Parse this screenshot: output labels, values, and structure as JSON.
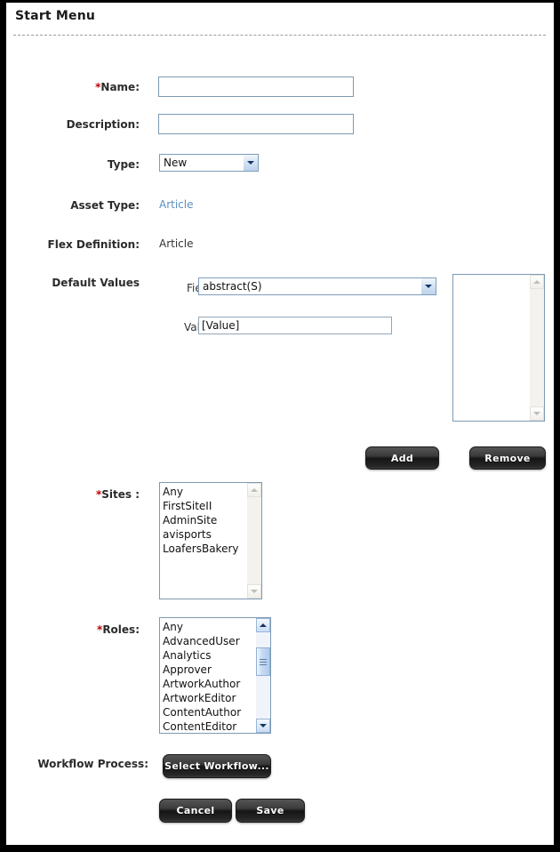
{
  "page": {
    "title": "Start Menu"
  },
  "form": {
    "name": {
      "label": "Name:",
      "required_marker": "*",
      "value": "",
      "placeholder": ""
    },
    "description": {
      "label": "Description:",
      "value": "",
      "placeholder": ""
    },
    "type": {
      "label": "Type:",
      "selected": "New",
      "options": [
        "New"
      ]
    },
    "asset_type": {
      "label": "Asset Type:",
      "value": "Article"
    },
    "flex_definition": {
      "label": "Flex Definition:",
      "value": "Article"
    },
    "default_values": {
      "label": "Default Values",
      "field": {
        "label": "Field:",
        "selected": "abstract(S)",
        "options": [
          "abstract(S)"
        ]
      },
      "value": {
        "label": "Value:",
        "value": "[Value]",
        "placeholder": ""
      },
      "selected_list": [],
      "add_button": "Add",
      "remove_button": "Remove"
    },
    "sites": {
      "label": "Sites :",
      "required_marker": "*",
      "items": [
        "Any",
        "FirstSiteII",
        "AdminSite",
        "avisports",
        "LoafersBakery"
      ],
      "scrollbar": {
        "state": "inactive"
      }
    },
    "roles": {
      "label": "Roles:",
      "required_marker": "*",
      "items": [
        "Any",
        "AdvancedUser",
        "Analytics",
        "Approver",
        "ArtworkAuthor",
        "ArtworkEditor",
        "ContentAuthor",
        "ContentEditor"
      ],
      "scrollbar": {
        "state": "active",
        "thumb_top_pct": 18,
        "thumb_height_pct": 33
      }
    },
    "workflow": {
      "label": "Workflow Process:",
      "select_button": "Select Workflow..."
    },
    "actions": {
      "cancel": "Cancel",
      "save": "Save"
    }
  },
  "colors": {
    "input_border": "#7d9ab3",
    "link": "#5b90c0",
    "required": "#c00000",
    "button_dark": "#262626",
    "frame": "#000000"
  },
  "icons": {
    "dropdown": "chevron-down-icon",
    "scroll_up": "scroll-up-arrow-icon",
    "scroll_down": "scroll-down-arrow-icon"
  }
}
